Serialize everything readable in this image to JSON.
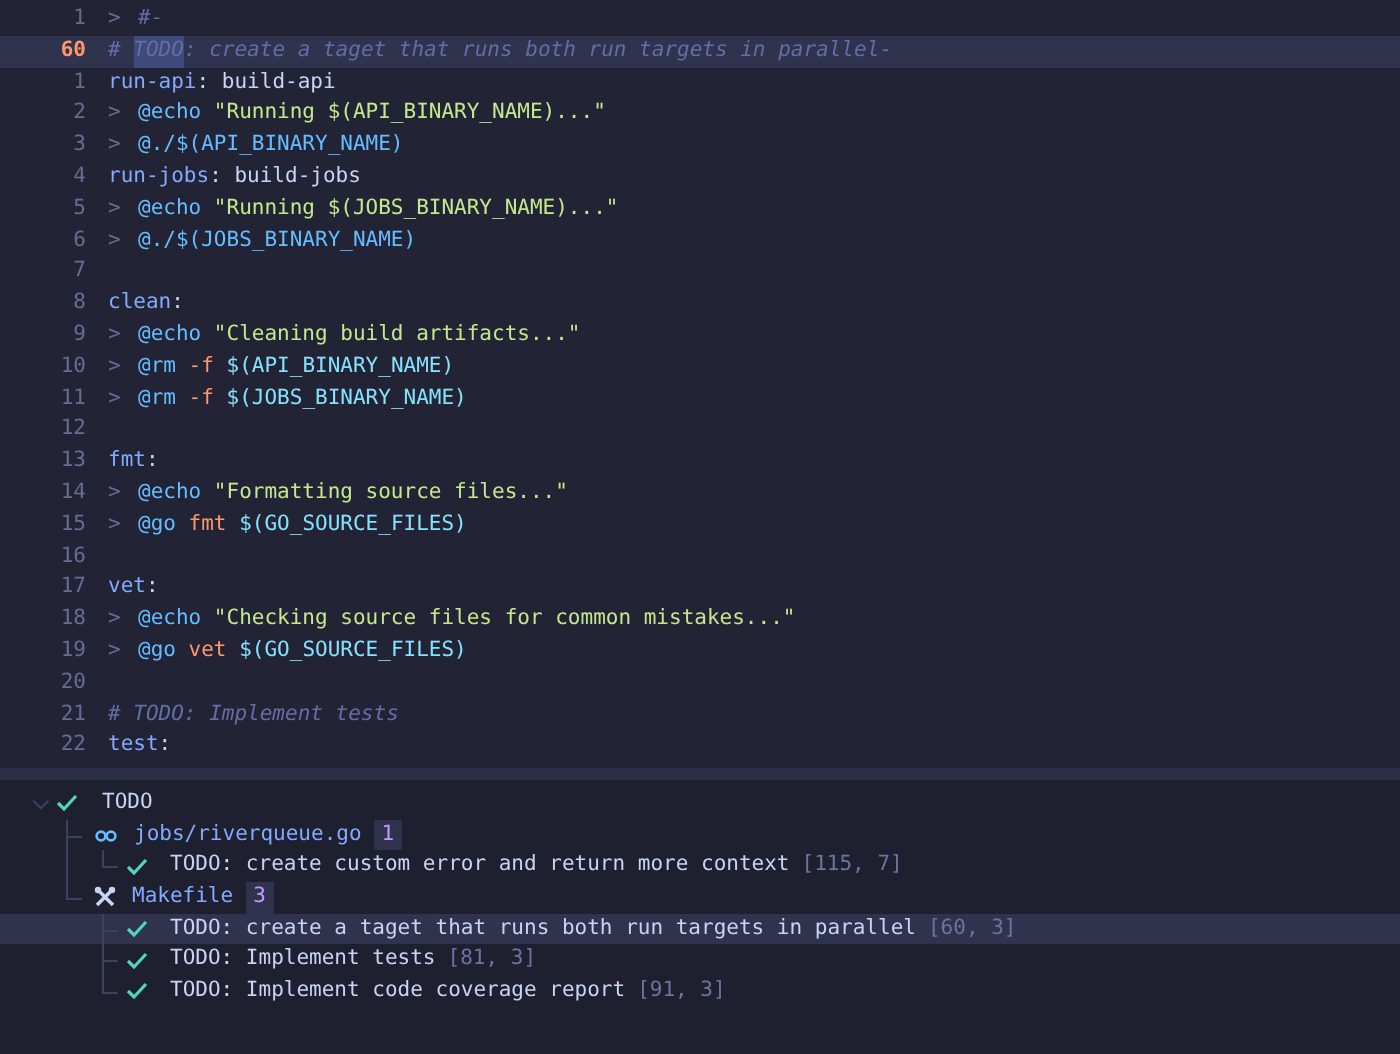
{
  "editor": {
    "lines": [
      {
        "number": "1",
        "selected": false,
        "marker": ">",
        "tokens": [
          {
            "text": "#-",
            "kind": "comment"
          }
        ]
      },
      {
        "number": "60",
        "selected": true,
        "tokens": [
          {
            "text": "# ",
            "kind": "comment"
          },
          {
            "text": "TODO",
            "kind": "match"
          },
          {
            "text": ": create a taget that runs both run targets in parallel",
            "kind": "comment"
          },
          {
            "text": "-",
            "kind": "whitespace"
          }
        ]
      },
      {
        "number": "1",
        "selected": false,
        "tokens": [
          {
            "text": "run-api",
            "kind": "target"
          },
          {
            "text": ": build-api",
            "kind": "plain"
          }
        ]
      },
      {
        "number": "2",
        "selected": false,
        "marker": ">",
        "tokens": [
          {
            "text": "@echo",
            "kind": "command"
          },
          {
            "text": " \"Running $(API_BINARY_NAME)...\"",
            "kind": "string"
          }
        ]
      },
      {
        "number": "3",
        "selected": false,
        "marker": ">",
        "tokens": [
          {
            "text": "@./$(API_BINARY_NAME)",
            "kind": "command"
          }
        ]
      },
      {
        "number": "4",
        "selected": false,
        "tokens": [
          {
            "text": "run-jobs",
            "kind": "target"
          },
          {
            "text": ": build-jobs",
            "kind": "plain"
          }
        ]
      },
      {
        "number": "5",
        "selected": false,
        "marker": ">",
        "tokens": [
          {
            "text": "@echo",
            "kind": "command"
          },
          {
            "text": " \"Running $(JOBS_BINARY_NAME)...\"",
            "kind": "string"
          }
        ]
      },
      {
        "number": "6",
        "selected": false,
        "marker": ">",
        "tokens": [
          {
            "text": "@./$(JOBS_BINARY_NAME)",
            "kind": "command"
          }
        ]
      },
      {
        "number": "7",
        "selected": false
      },
      {
        "number": "8",
        "selected": false,
        "tokens": [
          {
            "text": "clean",
            "kind": "target"
          },
          {
            "text": ":",
            "kind": "plain"
          }
        ]
      },
      {
        "number": "9",
        "selected": false,
        "marker": ">",
        "tokens": [
          {
            "text": "@echo",
            "kind": "command"
          },
          {
            "text": " \"Cleaning build artifacts...\"",
            "kind": "string"
          }
        ]
      },
      {
        "number": "10",
        "selected": false,
        "marker": ">",
        "tokens": [
          {
            "text": "@rm",
            "kind": "command"
          },
          {
            "text": " -f",
            "kind": "flag"
          },
          {
            "text": " $(API_BINARY_NAME)",
            "kind": "variable"
          }
        ]
      },
      {
        "number": "11",
        "selected": false,
        "marker": ">",
        "tokens": [
          {
            "text": "@rm",
            "kind": "command"
          },
          {
            "text": " -f",
            "kind": "flag"
          },
          {
            "text": " $(JOBS_BINARY_NAME)",
            "kind": "variable"
          }
        ]
      },
      {
        "number": "12",
        "selected": false
      },
      {
        "number": "13",
        "selected": false,
        "tokens": [
          {
            "text": "fmt",
            "kind": "target"
          },
          {
            "text": ":",
            "kind": "plain"
          }
        ]
      },
      {
        "number": "14",
        "selected": false,
        "marker": ">",
        "tokens": [
          {
            "text": "@echo",
            "kind": "command"
          },
          {
            "text": " \"Formatting source files...\"",
            "kind": "string"
          }
        ]
      },
      {
        "number": "15",
        "selected": false,
        "marker": ">",
        "tokens": [
          {
            "text": "@go",
            "kind": "command"
          },
          {
            "text": " fmt",
            "kind": "flag"
          },
          {
            "text": " $(GO_SOURCE_FILES)",
            "kind": "variable"
          }
        ]
      },
      {
        "number": "16",
        "selected": false
      },
      {
        "number": "17",
        "selected": false,
        "tokens": [
          {
            "text": "vet",
            "kind": "target"
          },
          {
            "text": ":",
            "kind": "plain"
          }
        ]
      },
      {
        "number": "18",
        "selected": false,
        "marker": ">",
        "tokens": [
          {
            "text": "@echo",
            "kind": "command"
          },
          {
            "text": " \"Checking source files for common mistakes...\"",
            "kind": "string"
          }
        ]
      },
      {
        "number": "19",
        "selected": false,
        "marker": ">",
        "tokens": [
          {
            "text": "@go",
            "kind": "command"
          },
          {
            "text": " vet",
            "kind": "flag"
          },
          {
            "text": " $(GO_SOURCE_FILES)",
            "kind": "variable"
          }
        ]
      },
      {
        "number": "20",
        "selected": false
      },
      {
        "number": "21",
        "selected": false,
        "tokens": [
          {
            "text": "# TODO: Implement tests",
            "kind": "comment"
          }
        ]
      },
      {
        "number": "22",
        "selected": false,
        "tokens": [
          {
            "text": "test",
            "kind": "target"
          },
          {
            "text": ":",
            "kind": "plain"
          }
        ]
      }
    ]
  },
  "todo_panel": {
    "label": "TODO",
    "expanded": true,
    "files": [
      {
        "name": "jobs/riverqueue.go",
        "kind": "go",
        "count": "1",
        "items": [
          {
            "text": "TODO: create custom error and return more context",
            "location": "[115, 7]",
            "selected": false
          }
        ]
      },
      {
        "name": "Makefile",
        "kind": "make",
        "count": "3",
        "items": [
          {
            "text": "TODO: create a taget that runs both run targets in parallel",
            "location": "[60, 3]",
            "selected": true
          },
          {
            "text": "TODO: Implement tests",
            "location": "[81, 3]",
            "selected": false
          },
          {
            "text": "TODO: Implement code coverage report",
            "location": "[91, 3]",
            "selected": false
          }
        ]
      }
    ]
  }
}
